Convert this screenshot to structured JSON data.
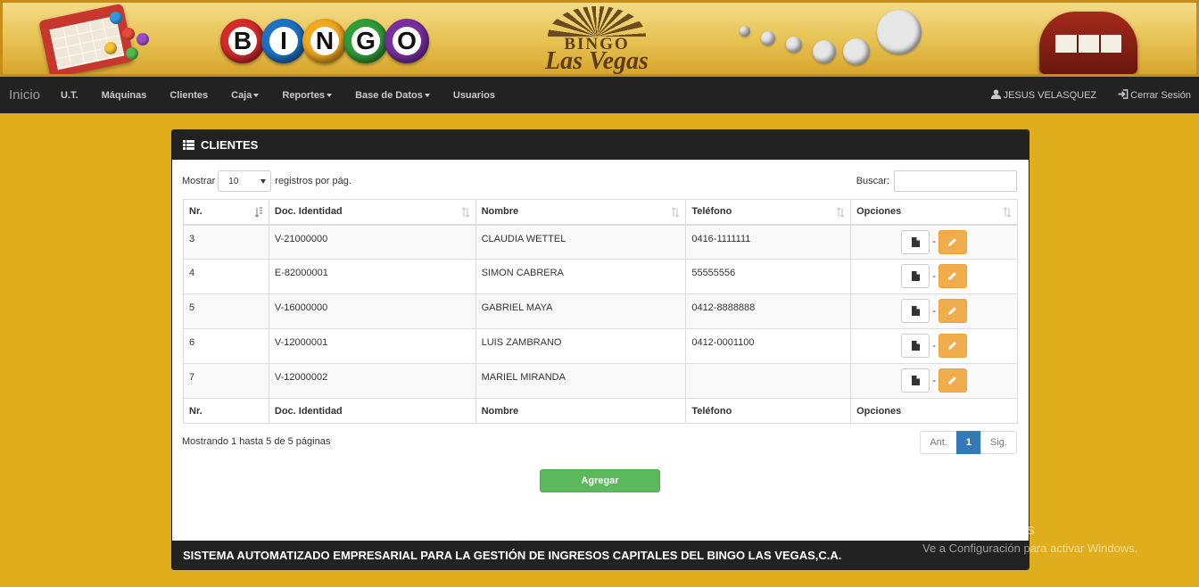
{
  "banner": {
    "bingo_letters": [
      "B",
      "I",
      "N",
      "G",
      "O"
    ],
    "logo_line1": "BINGO",
    "logo_line2": "Las Vegas"
  },
  "navbar": {
    "brand": "Inicio",
    "items": [
      {
        "label": "U.T.",
        "dropdown": false
      },
      {
        "label": "Máquinas",
        "dropdown": false
      },
      {
        "label": "Clientes",
        "dropdown": false
      },
      {
        "label": "Caja",
        "dropdown": true
      },
      {
        "label": "Reportes",
        "dropdown": true
      },
      {
        "label": "Base de Datos",
        "dropdown": true
      },
      {
        "label": "Usuarios",
        "dropdown": false
      }
    ],
    "user_label": "JESUS VELASQUEZ",
    "logout_label": "Cerrar Sesión"
  },
  "panel": {
    "title": "CLIENTES",
    "length_prefix": "Mostrar",
    "length_value": "10",
    "length_suffix": "registros por pág.",
    "search_label": "Buscar:",
    "search_value": "",
    "columns": [
      "Nr.",
      "Doc. Identidad",
      "Nombre",
      "Teléfono",
      "Opciones"
    ],
    "rows": [
      {
        "nr": "3",
        "doc": "V-21000000",
        "nombre": "CLAUDIA WETTEL",
        "telefono": "0416-1111111"
      },
      {
        "nr": "4",
        "doc": "E-82000001",
        "nombre": "SIMON CABRERA",
        "telefono": "55555556"
      },
      {
        "nr": "5",
        "doc": "V-16000000",
        "nombre": "GABRIEL MAYA",
        "telefono": "0412-8888888"
      },
      {
        "nr": "6",
        "doc": "V-12000001",
        "nombre": "LUIS ZAMBRANO",
        "telefono": "0412-0001100"
      },
      {
        "nr": "7",
        "doc": "V-12000002",
        "nombre": "MARIEL MIRANDA",
        "telefono": ""
      }
    ],
    "option_separator": "-",
    "info": "Mostrando 1 hasta 5 de 5 páginas",
    "pager": {
      "prev": "Ant.",
      "current": "1",
      "next": "Sig."
    },
    "add_button": "Agregar",
    "footer": "SISTEMA AUTOMATIZADO EMPRESARIAL PARA LA GESTIÓN DE INGRESOS CAPITALES DEL BINGO LAS VEGAS,C.A."
  },
  "watermark": {
    "line1": "Activar Windows",
    "line2": "Ve a Configuración para activar Windows."
  },
  "colors": {
    "page_background": "#e0ae1c",
    "navbar": "#222222",
    "primary": "#337ab7",
    "success": "#5cb85c",
    "warning": "#f0ad4e"
  },
  "icons": {
    "user": "user-icon",
    "logout": "logout-icon",
    "panel_title": "list-icon",
    "view": "file-icon",
    "edit": "pencil-icon"
  }
}
